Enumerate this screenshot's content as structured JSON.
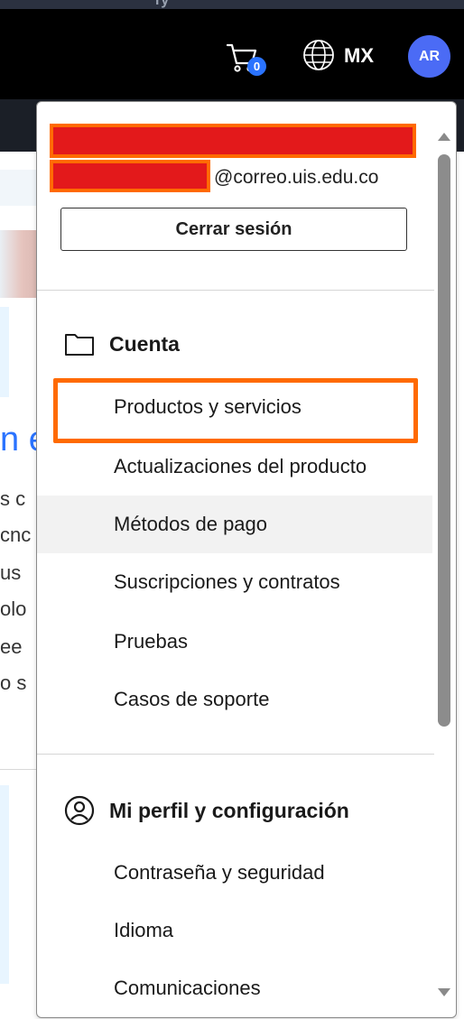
{
  "header": {
    "strip_text": "ry",
    "cart_count": "0",
    "region": "MX",
    "avatar_initials": "AR"
  },
  "background_page": {
    "heading_fragment": "n e",
    "text_lines": [
      "s c",
      "cnc",
      "us",
      "olo",
      "ee",
      "o s"
    ]
  },
  "account_menu": {
    "email_suffix": "@correo.uis.edu.co",
    "sign_out_label": "Cerrar sesión",
    "sections": [
      {
        "title": "Cuenta",
        "icon": "folder-icon",
        "items": [
          "Productos y servicios",
          "Actualizaciones del producto",
          "Métodos de pago",
          "Suscripciones y contratos",
          "Pruebas",
          "Casos de soporte"
        ]
      },
      {
        "title": "Mi perfil y configuración",
        "icon": "user-circle-icon",
        "items": [
          "Contraseña y seguridad",
          "Idioma",
          "Comunicaciones"
        ]
      }
    ]
  },
  "colors": {
    "accent_blue": "#2a73ff",
    "avatar_bg": "#4b6bf5",
    "highlight_orange": "#ff6a00",
    "redaction_red": "#e3191b"
  }
}
